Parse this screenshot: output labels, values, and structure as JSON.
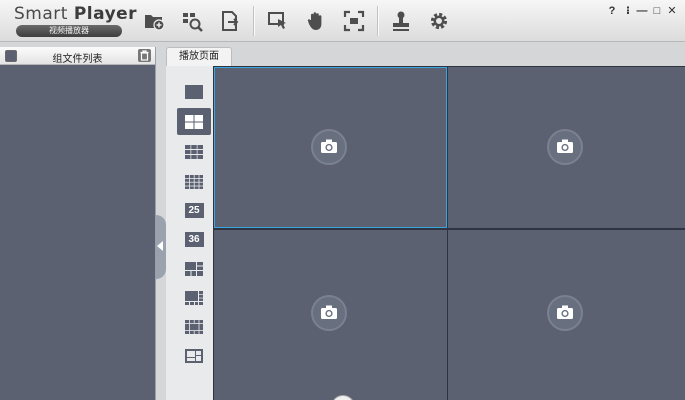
{
  "app": {
    "title_regular": "Smart ",
    "title_bold": "Player",
    "subtitle": "视频播放器"
  },
  "toolbar": {
    "icons": [
      "folder-add-icon",
      "zoom-search-icon",
      "file-export-icon",
      "cursor-select-icon",
      "hand-pan-icon",
      "fullscreen-icon",
      "stamp-icon",
      "settings-gear-icon"
    ]
  },
  "window_controls": {
    "help": "?",
    "pin": "⁝",
    "minimize": "—",
    "maximize": "□",
    "close": "✕"
  },
  "left_panel": {
    "title": "组文件列表"
  },
  "tab": {
    "label": "播放页面"
  },
  "layouts": {
    "num_25": "25",
    "num_36": "36",
    "active": "2x2"
  },
  "colors": {
    "cell_bg": "#5b6170",
    "selected_border": "#3aa6e0"
  }
}
